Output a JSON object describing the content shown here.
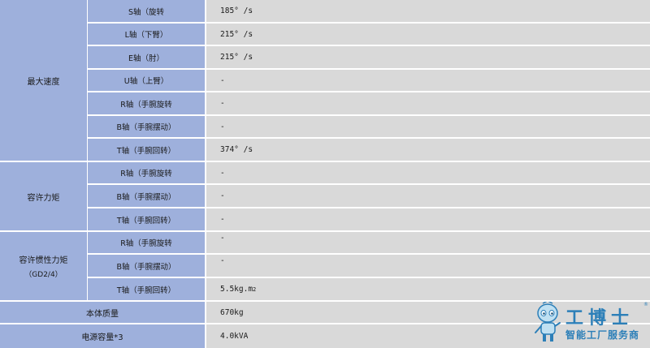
{
  "groups": {
    "max_speed": "最大速度",
    "allowable_moment": "容许力矩",
    "allowable_inertia": "容许惯性力矩",
    "allowable_inertia_note": "（GD2/4）"
  },
  "rows": [
    {
      "axis": "S轴（旋转",
      "value": "185° /s"
    },
    {
      "axis": "L轴（下臂）",
      "value": "215° /s"
    },
    {
      "axis": "E轴（肘）",
      "value": "215° /s"
    },
    {
      "axis": "U轴（上臂）",
      "value": "-"
    },
    {
      "axis": "R轴（手腕旋转",
      "value": "-"
    },
    {
      "axis": "B轴（手腕摆动）",
      "value": "-"
    },
    {
      "axis": "T轴（手腕回转）",
      "value": "374° /s"
    },
    {
      "axis": "R轴（手腕旋转",
      "value": "-"
    },
    {
      "axis": "B轴（手腕摆动）",
      "value": "-"
    },
    {
      "axis": "T轴（手腕回转）",
      "value": "-"
    },
    {
      "axis": "R轴（手腕旋转",
      "value": "-"
    },
    {
      "axis": "B轴（手腕摆动）",
      "value": "-"
    },
    {
      "axis": "T轴（手腕回转）",
      "value": "5.5kg.m",
      "sup": "2"
    }
  ],
  "bottom": [
    {
      "label": "本体质量",
      "value": "670kg"
    },
    {
      "label": "电源容量*3",
      "value": "4.0kVA"
    }
  ],
  "watermark": {
    "title": "工博士",
    "subtitle": "智能工厂服务商",
    "reg": "®",
    "accent": "#2c7fb8"
  }
}
